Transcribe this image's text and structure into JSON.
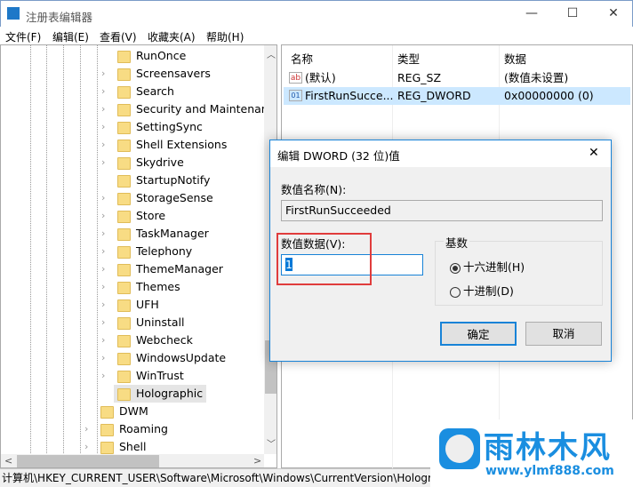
{
  "window": {
    "title": "注册表编辑器",
    "min": "—",
    "max": "☐",
    "close": "✕"
  },
  "menu": [
    "文件(F)",
    "编辑(E)",
    "查看(V)",
    "收藏夹(A)",
    "帮助(H)"
  ],
  "tree": {
    "items": [
      {
        "label": "RunOnce",
        "level": 2,
        "expand": false
      },
      {
        "label": "Screensavers",
        "level": 2,
        "expand": true
      },
      {
        "label": "Search",
        "level": 2,
        "expand": true
      },
      {
        "label": "Security and Maintenan",
        "level": 2,
        "expand": true
      },
      {
        "label": "SettingSync",
        "level": 2,
        "expand": true
      },
      {
        "label": "Shell Extensions",
        "level": 2,
        "expand": true
      },
      {
        "label": "Skydrive",
        "level": 2,
        "expand": true
      },
      {
        "label": "StartupNotify",
        "level": 2,
        "expand": false
      },
      {
        "label": "StorageSense",
        "level": 2,
        "expand": true
      },
      {
        "label": "Store",
        "level": 2,
        "expand": true
      },
      {
        "label": "TaskManager",
        "level": 2,
        "expand": true
      },
      {
        "label": "Telephony",
        "level": 2,
        "expand": true
      },
      {
        "label": "ThemeManager",
        "level": 2,
        "expand": true
      },
      {
        "label": "Themes",
        "level": 2,
        "expand": true
      },
      {
        "label": "UFH",
        "level": 2,
        "expand": true
      },
      {
        "label": "Uninstall",
        "level": 2,
        "expand": true
      },
      {
        "label": "Webcheck",
        "level": 2,
        "expand": true
      },
      {
        "label": "WindowsUpdate",
        "level": 2,
        "expand": true
      },
      {
        "label": "WinTrust",
        "level": 2,
        "expand": true
      },
      {
        "label": "Holographic",
        "level": 2,
        "expand": false,
        "selected": true
      },
      {
        "label": "DWM",
        "level": 1,
        "expand": false
      },
      {
        "label": "Roaming",
        "level": 1,
        "expand": true
      },
      {
        "label": "Shell",
        "level": 1,
        "expand": true
      }
    ]
  },
  "list": {
    "headers": [
      "名称",
      "类型",
      "数据"
    ],
    "rows": [
      {
        "icon": "string-value-icon",
        "name": "(默认)",
        "type": "REG_SZ",
        "data": "(数值未设置)"
      },
      {
        "icon": "binary-value-icon",
        "name": "FirstRunSucce...",
        "type": "REG_DWORD",
        "data": "0x00000000 (0)",
        "selected": true
      }
    ]
  },
  "status": "计算机\\HKEY_CURRENT_USER\\Software\\Microsoft\\Windows\\CurrentVersion\\Hologr",
  "dialog": {
    "title": "编辑 DWORD (32 位)值",
    "close": "✕",
    "name_label": "数值名称(N):",
    "name_value": "FirstRunSucceeded",
    "data_label": "数值数据(V):",
    "data_value": "1",
    "base_label": "基数",
    "hex_label": "十六进制(H)",
    "dec_label": "十进制(D)",
    "hex_selected": true,
    "ok": "确定",
    "cancel": "取消",
    "highlight_color": "#e03c3c"
  },
  "watermark": {
    "brand": "雨林木风",
    "url": "www.ylmf888.com",
    "color": "#1a8ee0"
  }
}
